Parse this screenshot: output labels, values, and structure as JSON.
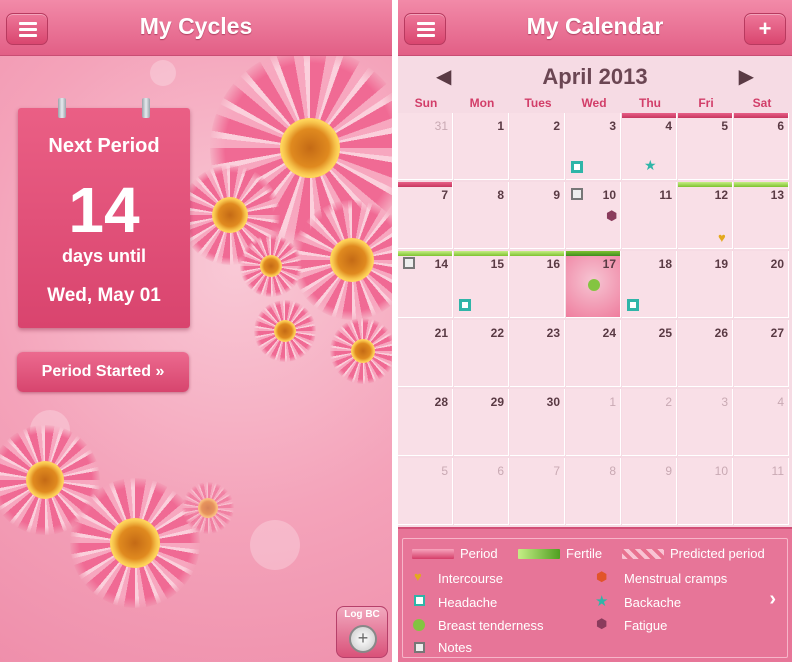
{
  "left": {
    "title": "My Cycles",
    "card": {
      "heading": "Next Period",
      "days": "14",
      "subtitle": "days until",
      "date": "Wed, May 01"
    },
    "button": "Period Started »",
    "log_label": "Log BC"
  },
  "right": {
    "title": "My Calendar",
    "add": "+",
    "month": "April 2013",
    "prev": "◀",
    "next": "▶",
    "weekdays": [
      "Sun",
      "Mon",
      "Tues",
      "Wed",
      "Thu",
      "Fri",
      "Sat"
    ],
    "days": [
      {
        "d": "31",
        "other": true
      },
      {
        "d": "1"
      },
      {
        "d": "2"
      },
      {
        "d": "3",
        "icons": [
          "headache"
        ]
      },
      {
        "d": "4",
        "bar": "period",
        "icons": [
          "backache"
        ]
      },
      {
        "d": "5",
        "bar": "period"
      },
      {
        "d": "6",
        "bar": "period"
      },
      {
        "d": "7",
        "bar": "period"
      },
      {
        "d": "8"
      },
      {
        "d": "9"
      },
      {
        "d": "10",
        "icons": [
          "notes",
          "fatigue"
        ]
      },
      {
        "d": "11"
      },
      {
        "d": "12",
        "bar": "fertile",
        "icons": [
          "intercourse"
        ]
      },
      {
        "d": "13",
        "bar": "fertile"
      },
      {
        "d": "14",
        "bar": "fertile",
        "icons": [
          "notes"
        ]
      },
      {
        "d": "15",
        "bar": "fertile",
        "icons": [
          "headache"
        ]
      },
      {
        "d": "16",
        "bar": "fertile"
      },
      {
        "d": "17",
        "bar": "ovul",
        "today": true,
        "icons": [
          "breast"
        ]
      },
      {
        "d": "18",
        "icons": [
          "headache"
        ]
      },
      {
        "d": "19"
      },
      {
        "d": "20"
      },
      {
        "d": "21"
      },
      {
        "d": "22"
      },
      {
        "d": "23"
      },
      {
        "d": "24"
      },
      {
        "d": "25"
      },
      {
        "d": "26"
      },
      {
        "d": "27"
      },
      {
        "d": "28"
      },
      {
        "d": "29"
      },
      {
        "d": "30"
      },
      {
        "d": "1",
        "other": true
      },
      {
        "d": "2",
        "other": true
      },
      {
        "d": "3",
        "other": true
      },
      {
        "d": "4",
        "other": true
      },
      {
        "d": "5",
        "other": true
      },
      {
        "d": "6",
        "other": true
      },
      {
        "d": "7",
        "other": true
      },
      {
        "d": "8",
        "other": true
      },
      {
        "d": "9",
        "other": true
      },
      {
        "d": "10",
        "other": true
      },
      {
        "d": "11",
        "other": true
      }
    ],
    "legend": {
      "period": "Period",
      "fertile": "Fertile",
      "predicted": "Predicted period",
      "intercourse": "Intercourse",
      "headache": "Headache",
      "breast": "Breast tenderness",
      "notes": "Notes",
      "cramps": "Menstrual cramps",
      "backache": "Backache",
      "fatigue": "Fatigue"
    }
  },
  "colors": {
    "accent": "#e25f86",
    "period": "#d23e69",
    "fertile": "#84c441",
    "symptom_teal": "#2fb5a8",
    "intercourse": "#e3a91e",
    "cramps": "#e2542a",
    "fatigue": "#8a3b5c"
  }
}
